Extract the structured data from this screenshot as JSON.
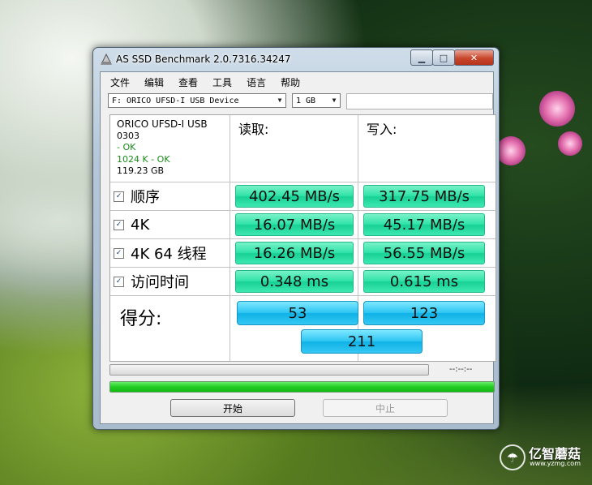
{
  "window": {
    "title": "AS SSD Benchmark 2.0.7316.34247"
  },
  "menu": [
    "文件",
    "编辑",
    "查看",
    "工具",
    "语言",
    "帮助"
  ],
  "drive_select": {
    "value": "F: ORICO UFSD-I USB Device"
  },
  "size_select": {
    "value": "1 GB"
  },
  "device": {
    "model": "ORICO UFSD-I USB",
    "firmware": "0303",
    "status1": " - OK",
    "status2": "1024 K - OK",
    "capacity": "119.23 GB"
  },
  "columns": {
    "read": "读取:",
    "write": "写入:"
  },
  "rows": [
    {
      "label": "顺序",
      "read": "402.45 MB/s",
      "write": "317.75 MB/s",
      "checked": "✓"
    },
    {
      "label": "4K",
      "read": "16.07 MB/s",
      "write": "45.17 MB/s",
      "checked": "✓"
    },
    {
      "label": "4K 64 线程",
      "read": "16.26 MB/s",
      "write": "56.55 MB/s",
      "checked": "✓"
    },
    {
      "label": "访问时间",
      "read": "0.348 ms",
      "write": "0.615 ms",
      "checked": "✓"
    }
  ],
  "score": {
    "label": "得分:",
    "read": "53",
    "write": "123",
    "total": "211"
  },
  "progress": {
    "time": "--:--:--",
    "bottom_fill": 1.0
  },
  "buttons": {
    "start": "开始",
    "stop": "中止"
  },
  "watermark": {
    "name": "亿智蘑菇",
    "url": "www.yzmg.com"
  },
  "colors": {
    "result_green": "#2fe3a8",
    "score_blue": "#2fc6f2"
  }
}
